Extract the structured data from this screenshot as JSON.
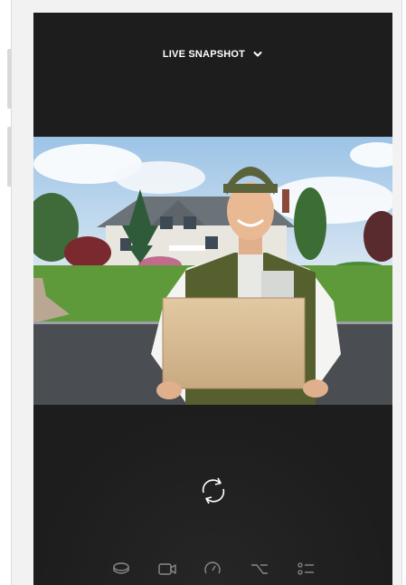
{
  "header": {
    "title": "LIVE SNAPSHOT"
  },
  "icons": {
    "dropdown": "chevron-down-icon",
    "refresh": "refresh-icon",
    "nav": [
      "device-icon",
      "video-camera-icon",
      "speed-gauge-icon",
      "route-icon",
      "settings-list-icon"
    ]
  },
  "colors": {
    "screen_bg": "#1d1d1d",
    "text": "#ffffff",
    "icon_muted": "#8a8a8a"
  }
}
